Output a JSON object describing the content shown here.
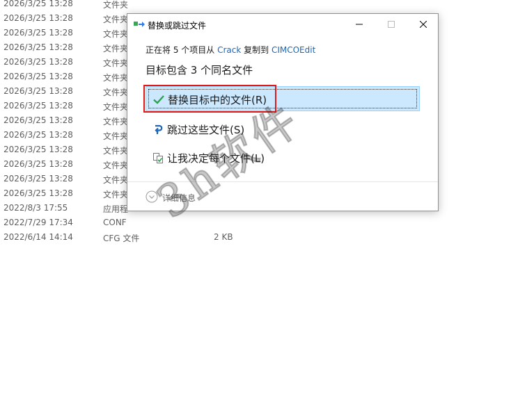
{
  "file_rows": [
    {
      "date": "2026/3/25 13:28",
      "type": "文件夹",
      "size": ""
    },
    {
      "date": "2026/3/25 13:28",
      "type": "文件夹",
      "size": ""
    },
    {
      "date": "2026/3/25 13:28",
      "type": "文件夹",
      "size": ""
    },
    {
      "date": "2026/3/25 13:28",
      "type": "文件夹",
      "size": ""
    },
    {
      "date": "2026/3/25 13:28",
      "type": "文件夹",
      "size": ""
    },
    {
      "date": "2026/3/25 13:28",
      "type": "文件夹",
      "size": ""
    },
    {
      "date": "2026/3/25 13:28",
      "type": "文件夹",
      "size": ""
    },
    {
      "date": "2026/3/25 13:28",
      "type": "文件夹",
      "size": ""
    },
    {
      "date": "2026/3/25 13:28",
      "type": "文件夹",
      "size": ""
    },
    {
      "date": "2026/3/25 13:28",
      "type": "文件夹",
      "size": ""
    },
    {
      "date": "2026/3/25 13:28",
      "type": "文件夹",
      "size": ""
    },
    {
      "date": "2026/3/25 13:28",
      "type": "文件夹",
      "size": ""
    },
    {
      "date": "2026/3/25 13:28",
      "type": "文件夹",
      "size": ""
    },
    {
      "date": "2026/3/25 13:28",
      "type": "文件夹",
      "size": ""
    },
    {
      "date": "2022/8/3 17:55",
      "type": "应用程",
      "size": ""
    },
    {
      "date": "2022/7/29 17:34",
      "type": "CONF",
      "size": ""
    },
    {
      "date": "2022/6/14 14:14",
      "type": "CFG 文件",
      "size": "2 KB"
    }
  ],
  "dialog": {
    "title": "替换或跳过文件",
    "subtitle": {
      "prefix": "正在将 5 个项目从 ",
      "source": "Crack",
      "middle": " 复制到 ",
      "dest": "CIMCOEdit"
    },
    "heading": "目标包含 3 个同名文件",
    "options": {
      "replace": "替换目标中的文件(R)",
      "skip": "跳过这些文件(S)",
      "decide": "让我决定每个文件(L)"
    },
    "details": "详细信息"
  },
  "watermark": "3h软件",
  "colors": {
    "accent": "#1e66b5",
    "selection": "#cce8ff",
    "highlight": "#e01818",
    "check": "#2ea04f"
  }
}
